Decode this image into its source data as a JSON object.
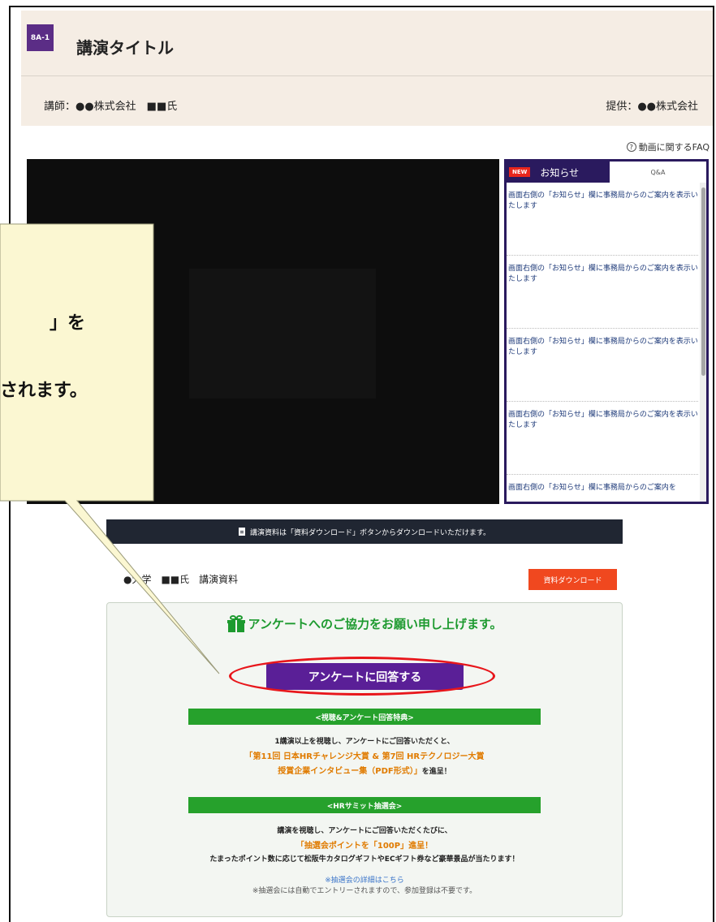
{
  "header": {
    "session_code": "8A-1",
    "title": "講演タイトル",
    "speaker": "講師：●●株式会社　■■氏",
    "sponsor": "提供：●●株式会社"
  },
  "faq": {
    "label": "動画に関するFAQ",
    "icon": "question-circle-icon"
  },
  "notice_panel": {
    "new_badge": "NEW",
    "tab_notice": "お知らせ",
    "tab_qa": "Q&A",
    "items": [
      "画面右側の「お知らせ」欄に事務局からのご案内を表示いたします",
      "画面右側の「お知らせ」欄に事務局からのご案内を表示いたします",
      "画面右側の「お知らせ」欄に事務局からのご案内を表示いたします",
      "画面右側の「お知らせ」欄に事務局からのご案内を表示いたします",
      "画面右側の「お知らせ」欄に事務局からのご案内を"
    ]
  },
  "download_bar": {
    "text": "講演資料は「資料ダウンロード」ボタンからダウンロードいただけます。"
  },
  "material": {
    "label": "●大学　■■氏　講演資料",
    "button": "資料ダウンロード"
  },
  "survey": {
    "heading": "アンケートへのご協力をお願い申し上げます。",
    "button": "アンケートに回答する",
    "section1_title": "<視聴&アンケート回答特典>",
    "section1_line1": "1講演以上を視聴し、アンケートにご回答いただくと、",
    "section1_line2": "「第11回 日本HRチャレンジ大賞 & 第7回 HRテクノロジー大賞",
    "section1_line3": "授賞企業インタビュー集（PDF形式）」",
    "section1_line3_suffix": "を進呈！",
    "section2_title": "<HRサミット抽選会>",
    "section2_line1": "講演を視聴し、アンケートにご回答いただくたびに、",
    "section2_line2": "「抽選会ポイントを「100P」進呈！",
    "section2_line3": "たまったポイント数に応じて松阪牛カタログギフトやECギフト券など豪華景品が当たります！",
    "section2_link": "※抽選会の詳細はこちら",
    "section2_note": "※抽選会には自動でエントリーされますので、参加登録は不要です。"
  },
  "callout": {
    "line1": "」を",
    "line2": "されます。"
  }
}
